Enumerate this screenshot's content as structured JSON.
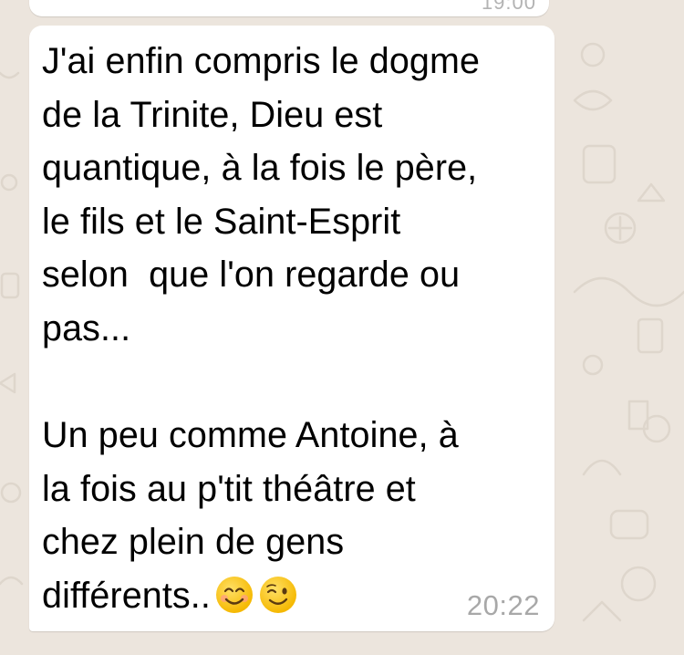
{
  "previous_message": {
    "time_partial": "19:00"
  },
  "message": {
    "lines": [
      "J'ai enfin compris le dogme",
      "de la Trinite, Dieu est",
      "quantique, à la fois le père,",
      "le fils et le Saint-Esprit",
      "selon  que l'on regarde ou",
      "pas...",
      "",
      "Un peu comme Antoine, à",
      "la fois au p'tit théâtre et",
      "chez plein de gens",
      "différents.."
    ],
    "emojis": [
      "smiling-face-with-smiling-eyes",
      "winking-face"
    ],
    "time": "20:22"
  },
  "colors": {
    "wallpaper": "#ECE5DD",
    "bubble": "#FFFFFF",
    "time_text": "#A8A8A8",
    "emoji_face": "#FFCC33"
  }
}
